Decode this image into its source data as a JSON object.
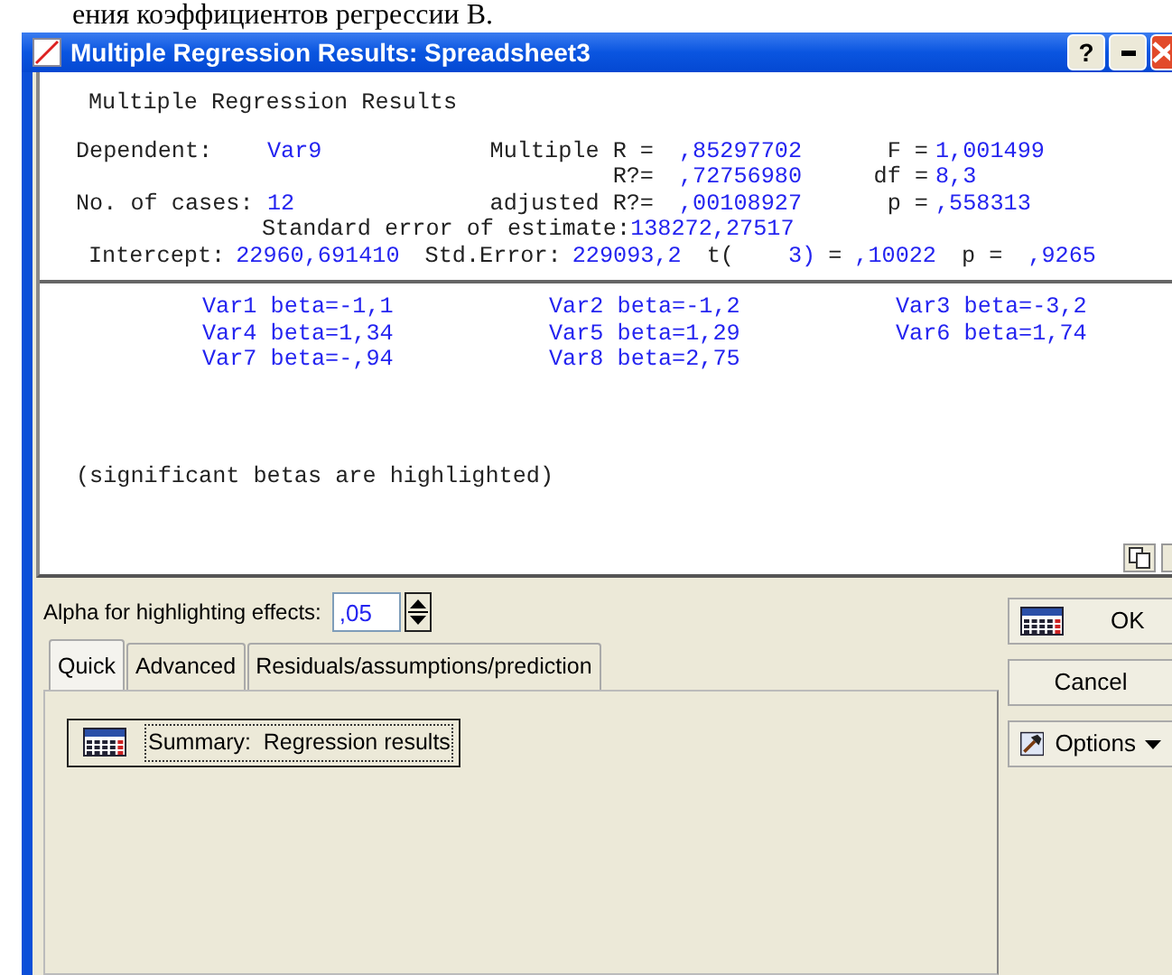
{
  "page_caption": "ения коэффициентов регрессии B.",
  "window": {
    "title": "Multiple Regression Results: Spreadsheet3",
    "help_button": "?"
  },
  "report": {
    "title": "Multiple Regression Results",
    "stat_rows": [
      {
        "left": {
          "label": "Dependent:",
          "value": "Var9"
        },
        "middle": {
          "label": "Multiple R =",
          "value": ",85297702"
        },
        "right": {
          "label": "F =",
          "value": "1,001499"
        }
      },
      {
        "middle": {
          "label": "R?=",
          "value": ",72756980"
        },
        "right": {
          "label": "df =",
          "value": "8,3"
        }
      },
      {
        "left": {
          "label": "No. of cases:",
          "value": "12"
        },
        "middle": {
          "label": "adjusted R?=",
          "value": ",00108927"
        },
        "right": {
          "label": "p =",
          "value": ",558313"
        }
      }
    ],
    "std_error_estimate": {
      "label": "Standard error of estimate:",
      "value": "138272,27517"
    },
    "intercept_line": [
      {
        "kind": "label",
        "text": "Intercept:"
      },
      {
        "kind": "value",
        "text": "22960,691410"
      },
      {
        "kind": "label",
        "text": "Std.Error:"
      },
      {
        "kind": "value",
        "text": "229093,2"
      },
      {
        "kind": "label",
        "text": "t("
      },
      {
        "kind": "value",
        "text": "3)"
      },
      {
        "kind": "label",
        "text": "="
      },
      {
        "kind": "value",
        "text": ",10022"
      },
      {
        "kind": "label",
        "text": "p ="
      },
      {
        "kind": "value",
        "text": ",9265"
      }
    ],
    "betas": [
      "Var1 beta=-1,1",
      "Var2 beta=-1,2",
      "Var3 beta=-3,2",
      "Var4 beta=1,34",
      "Var5 beta=1,29",
      "Var6 beta=1,74",
      "Var7 beta=-,94",
      "Var8 beta=2,75"
    ],
    "note": "(significant betas are highlighted)"
  },
  "alpha": {
    "label": "Alpha for highlighting effects:",
    "value": ",05"
  },
  "tabs": [
    {
      "label": "Quick",
      "selected": true
    },
    {
      "label": "Advanced",
      "selected": false
    },
    {
      "label": "Residuals/assumptions/prediction",
      "selected": false
    }
  ],
  "summary_button": "Summary:  Regression results",
  "buttons": [
    {
      "kind": "ok",
      "label": "OK"
    },
    {
      "kind": "plain",
      "label": "Cancel"
    },
    {
      "kind": "menu",
      "label": "Options"
    }
  ]
}
